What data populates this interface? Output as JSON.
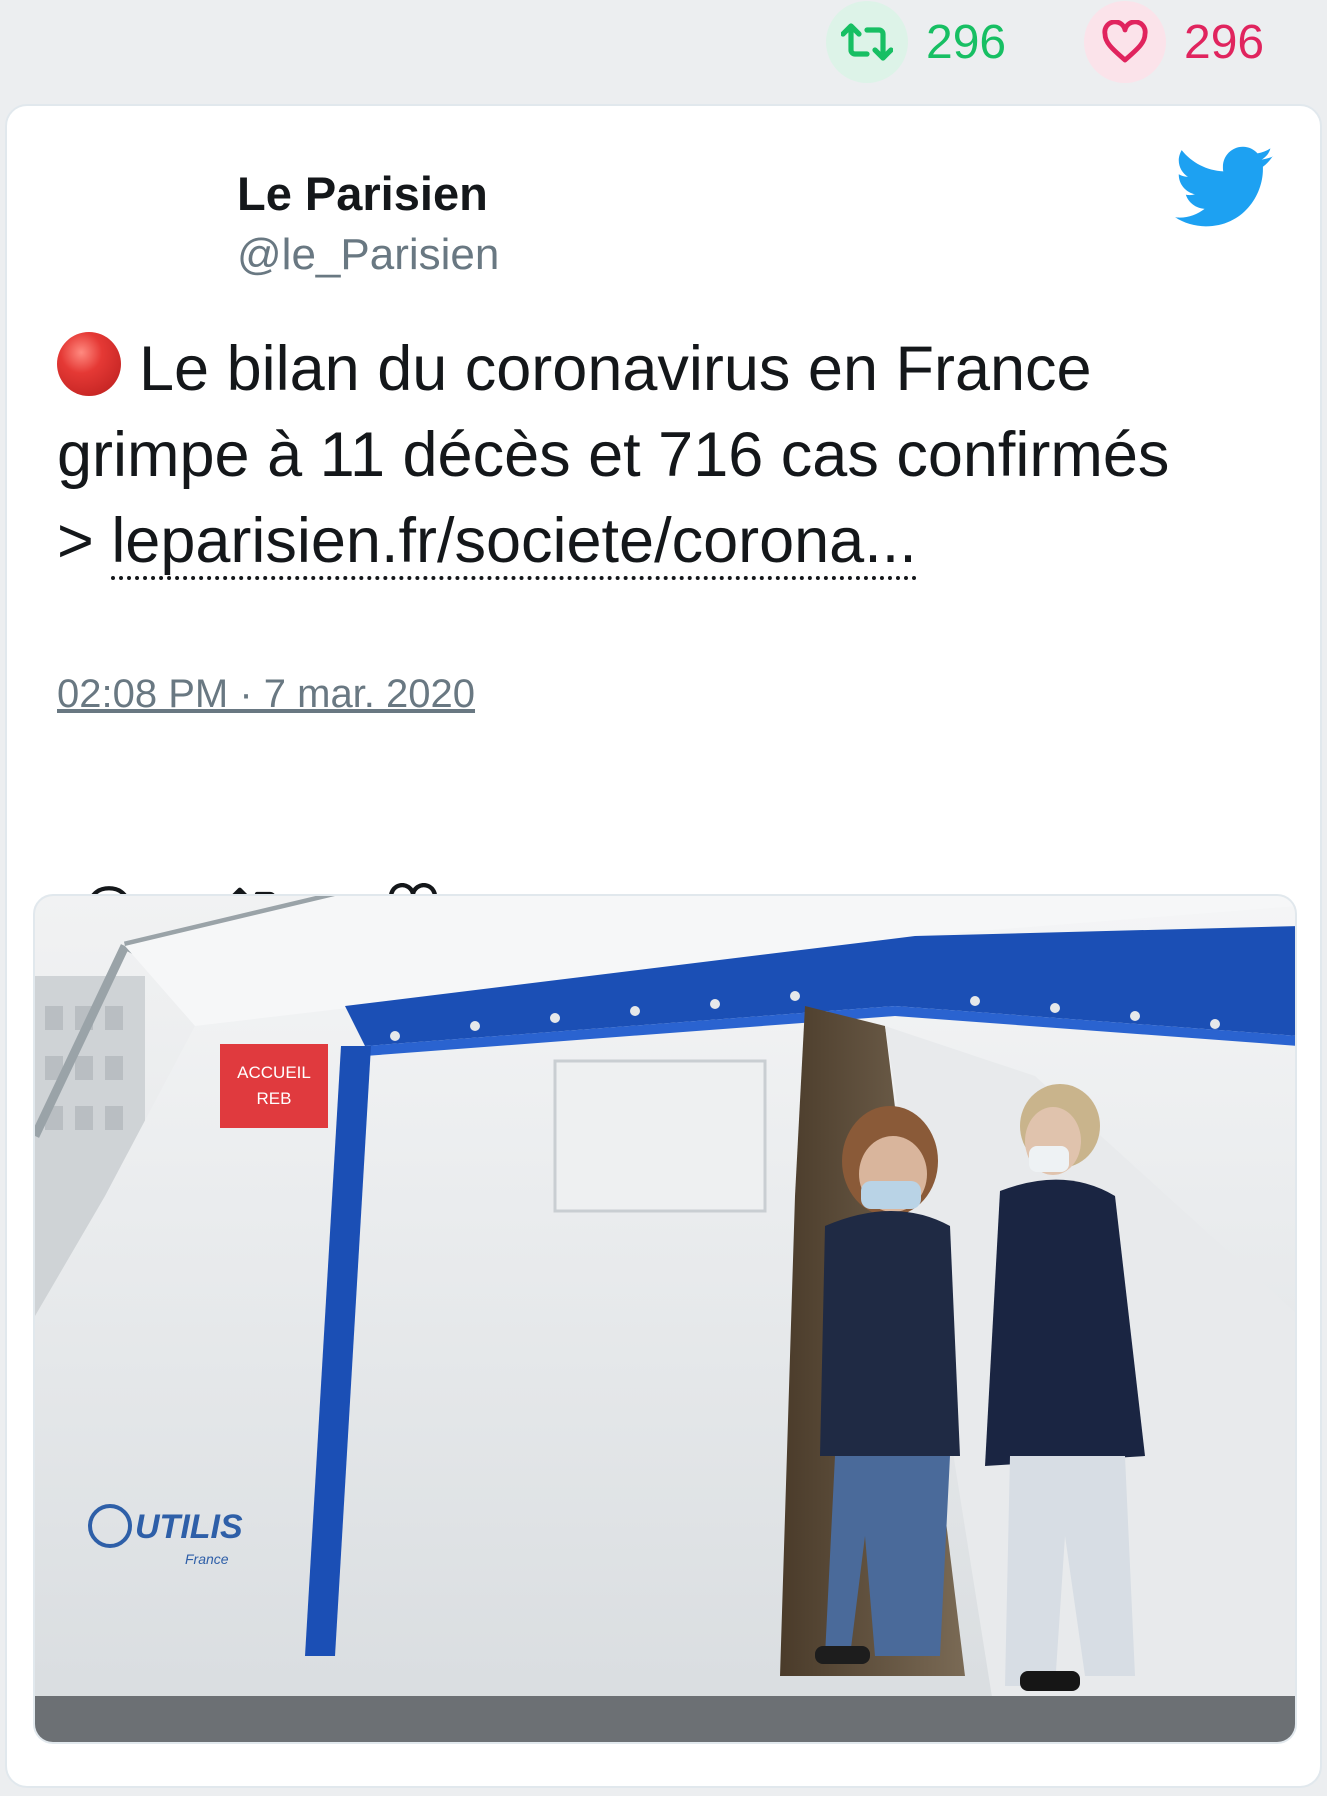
{
  "stats": {
    "retweets": "296",
    "likes": "296"
  },
  "tweet": {
    "author_name": "Le Parisien",
    "author_handle": "@le_Parisien",
    "text_main": "Le bilan du coronavirus en France grimpe à 11 décès et 716 cas confirmés",
    "text_prefix": ">",
    "link": "leparisien.fr/societe/corona...",
    "timestamp": "02:08 PM · 7 mar. 2020"
  },
  "media": {
    "sign_line1": "ACCUEIL",
    "sign_line2": "REB",
    "brand": "UTILIS",
    "brand_sub": "France"
  },
  "icons": {
    "top_retweet": "retweet-icon",
    "top_like": "heart-icon",
    "brand": "twitter-bird-icon",
    "live": "red-circle-icon",
    "reply": "reply-icon",
    "retweet": "retweet-icon",
    "like": "heart-icon"
  },
  "colors": {
    "retweet": "#17bf63",
    "like": "#e0245e",
    "twitter_blue": "#1da1f2",
    "text": "#14171a",
    "muted": "#697882"
  }
}
